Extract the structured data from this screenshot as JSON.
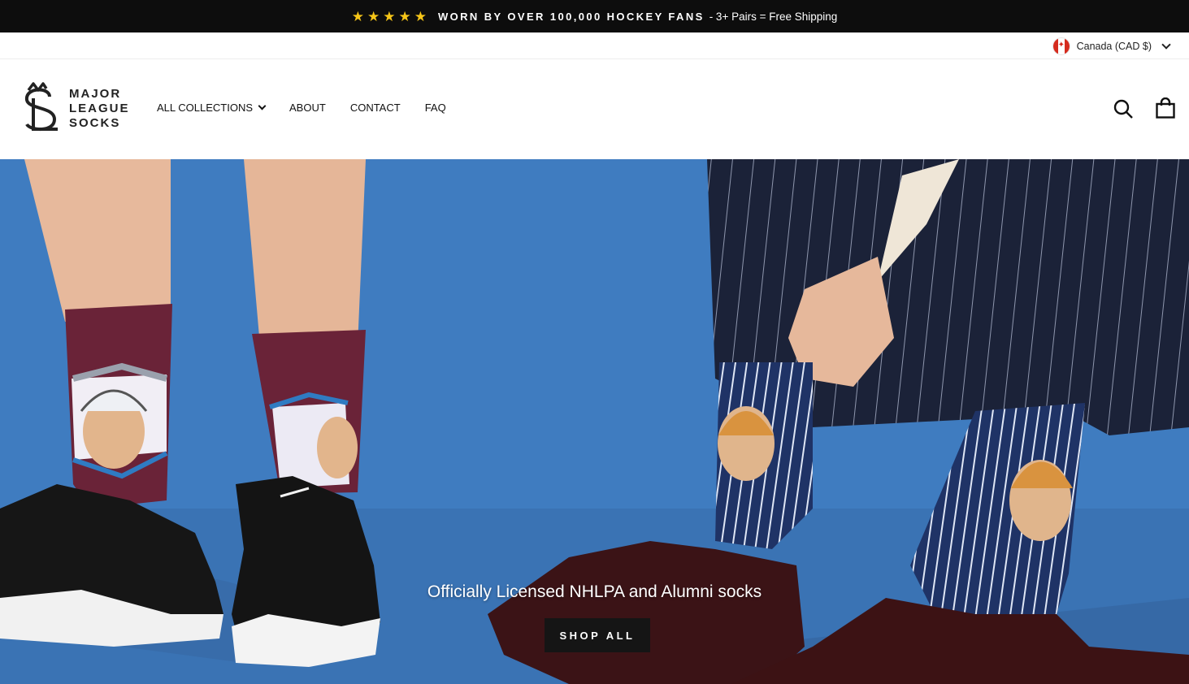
{
  "announcement": {
    "stars": [
      "★",
      "★",
      "★",
      "★",
      "★"
    ],
    "headline": "WORN BY OVER 100,000 HOCKEY FANS",
    "detail": "- 3+ Pairs = Free Shipping"
  },
  "locale": {
    "label": "Canada (CAD $)",
    "flag_icon": "canada-flag-icon"
  },
  "brand": {
    "line1": "MAJOR",
    "line2": "LEAGUE",
    "line3": "SOCKS"
  },
  "nav": [
    {
      "label": "ALL COLLECTIONS",
      "has_dropdown": true
    },
    {
      "label": "ABOUT"
    },
    {
      "label": "CONTACT"
    },
    {
      "label": "FAQ"
    }
  ],
  "icons": {
    "search": "search-icon",
    "cart": "shopping-bag-icon"
  },
  "hero": {
    "tagline": "Officially Licensed NHLPA and Alumni socks",
    "cta_label": "SHOP ALL",
    "background_color": "#3e7bbf"
  }
}
